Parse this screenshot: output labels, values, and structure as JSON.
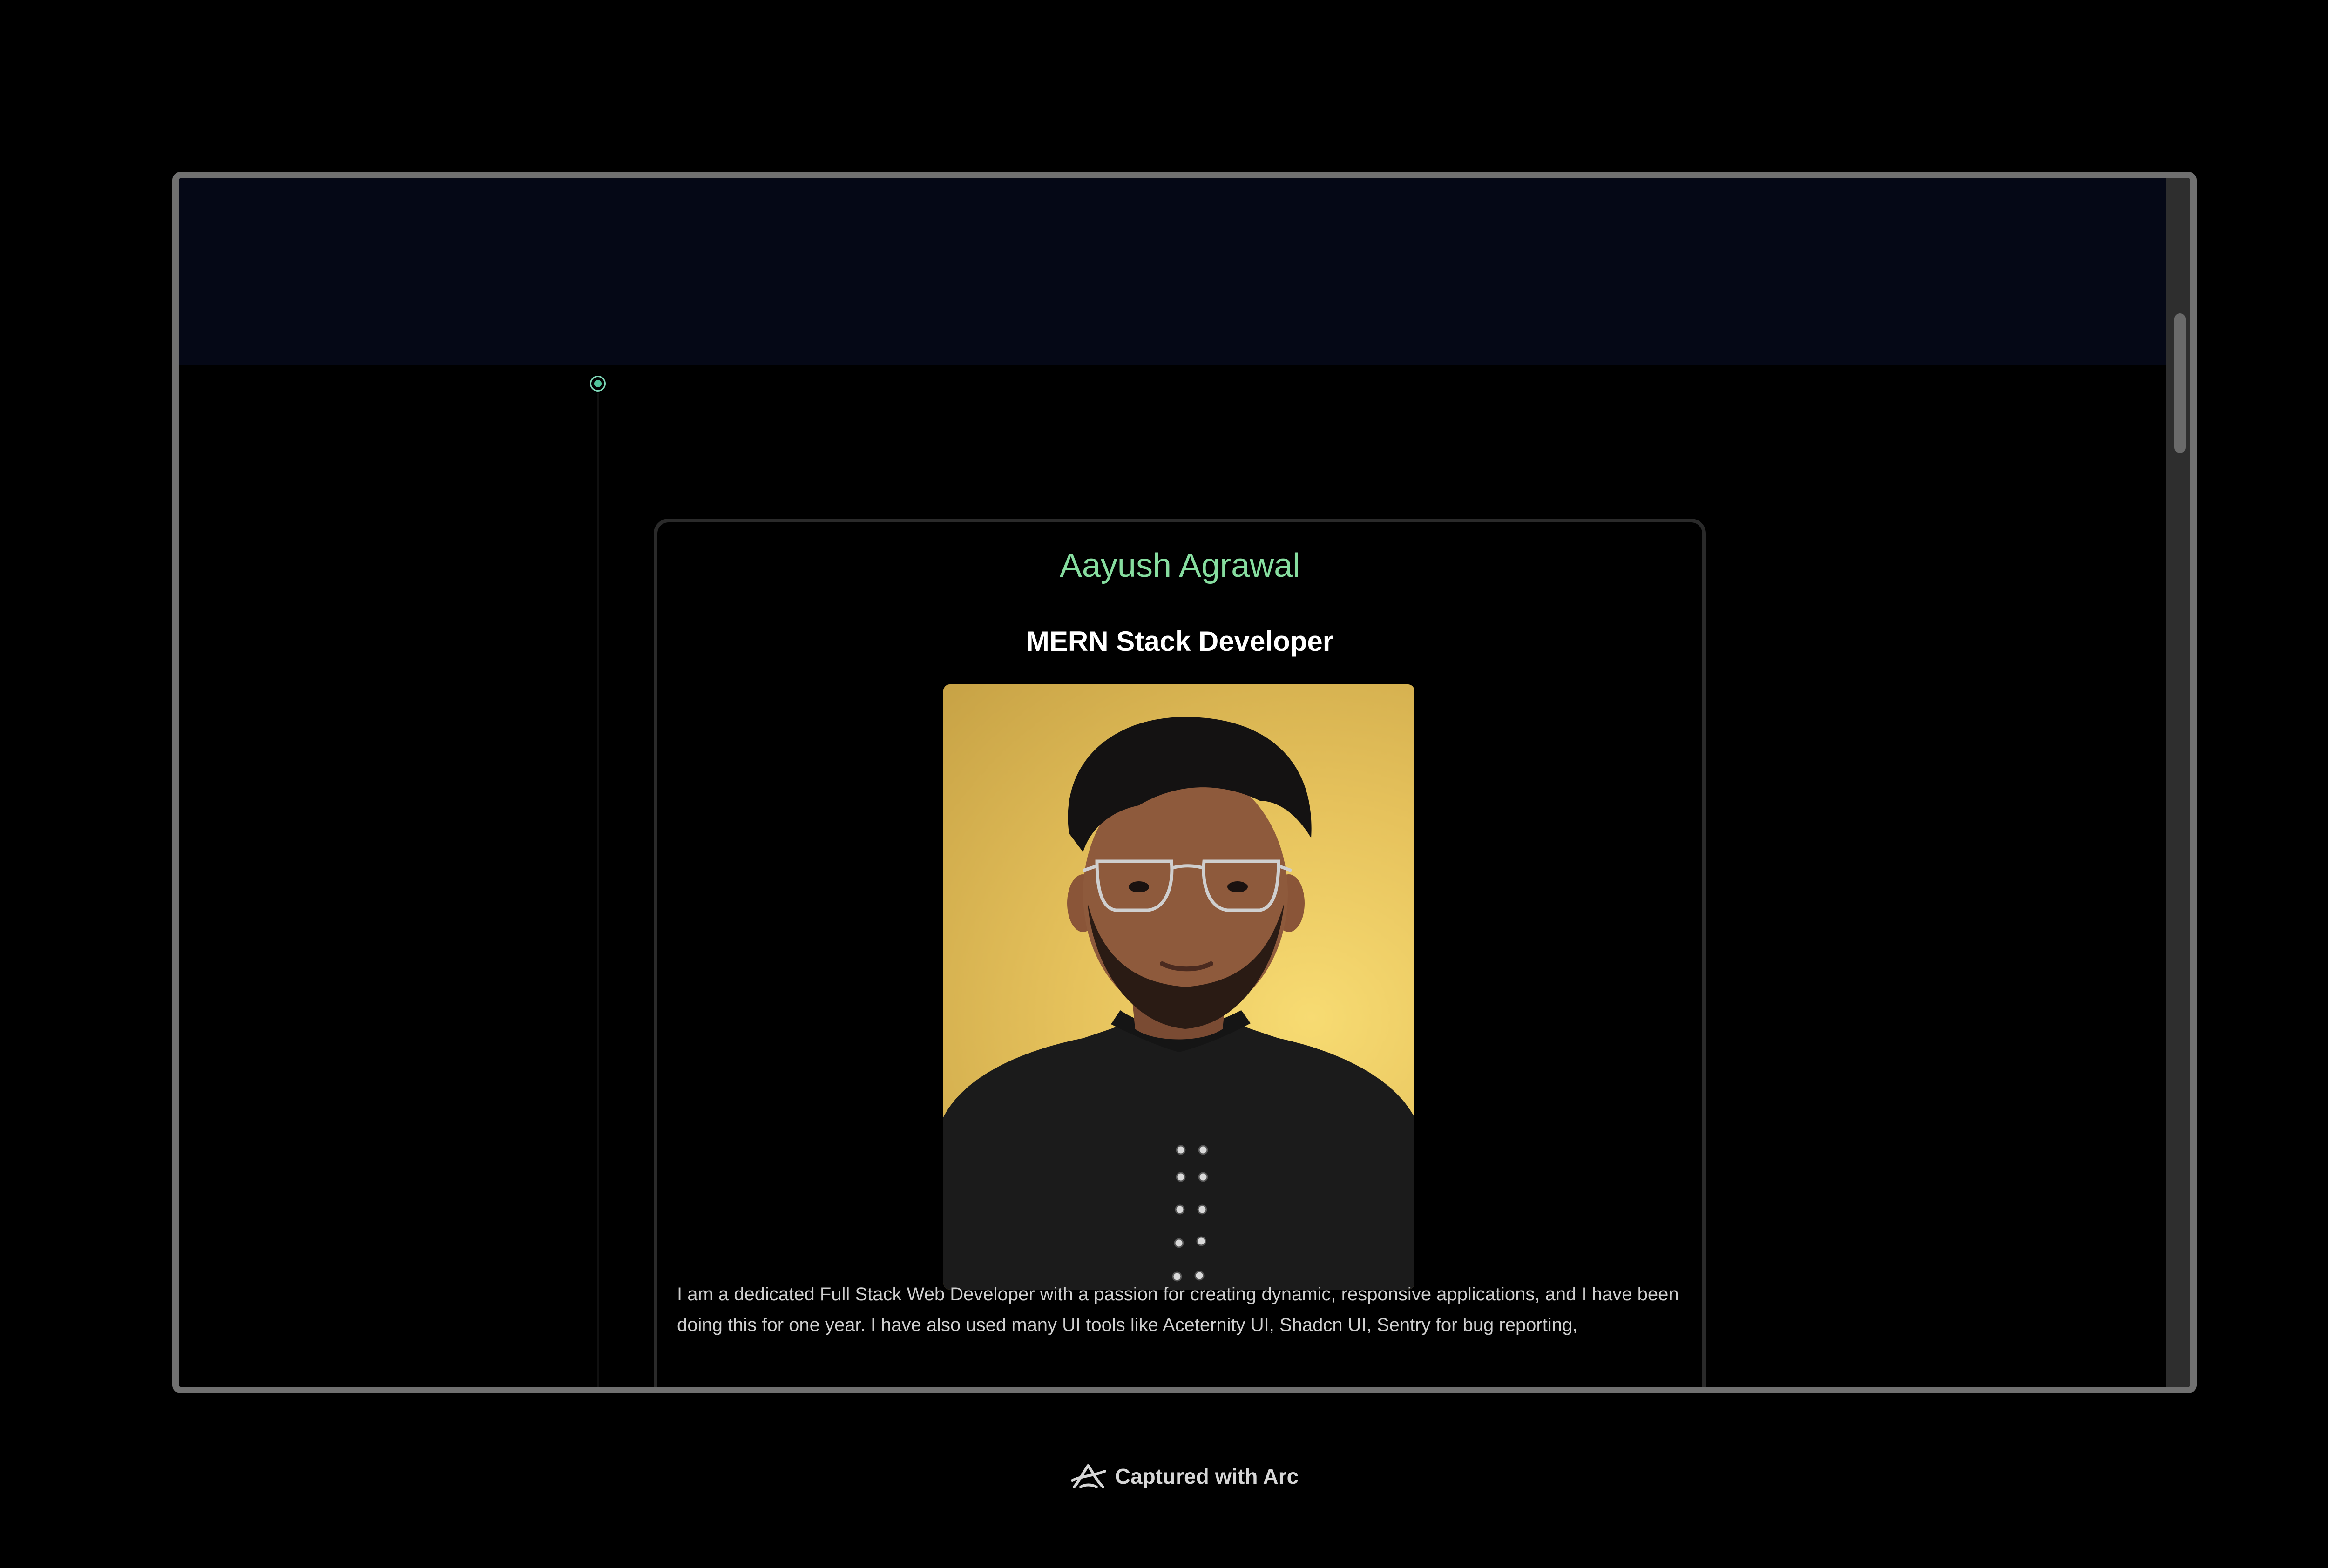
{
  "profile": {
    "name": "Aayush Agrawal",
    "role": "MERN Stack Developer",
    "bio": "I am a dedicated Full Stack Web Developer with a passion for creating dynamic, responsive applications, and I have been doing this for one year. I have also used many UI tools like Aceternity UI, Shadcn UI, Sentry for bug reporting,"
  },
  "footer": {
    "label": "Captured with Arc",
    "icon": "arc-logo-icon"
  },
  "colors": {
    "page_background": "#000000",
    "header_band": "#050816",
    "name_accent": "#86dd9f",
    "timeline_dot": "#4fc39a",
    "photo_background": "#e6c25c"
  }
}
